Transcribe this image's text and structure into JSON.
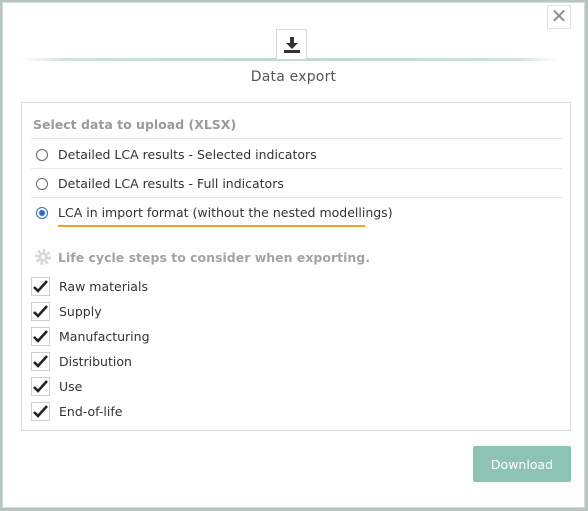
{
  "dialog": {
    "close_label": "✕",
    "title": "Data export",
    "header_icon": "download-icon"
  },
  "export": {
    "section_label": "Select data to upload (XLSX)",
    "options": [
      {
        "label": "Detailed LCA results - Selected indicators",
        "checked": false
      },
      {
        "label": "Detailed LCA results - Full indicators",
        "checked": false
      },
      {
        "label": "LCA in import format (without the nested modellings)",
        "checked": true
      }
    ],
    "highlight_color": "#f0a224"
  },
  "steps": {
    "label": "Life cycle steps to consider when exporting.",
    "icon": "gear-icon",
    "items": [
      {
        "label": "Raw materials",
        "checked": true
      },
      {
        "label": "Supply",
        "checked": true
      },
      {
        "label": "Manufacturing",
        "checked": true
      },
      {
        "label": "Distribution",
        "checked": true
      },
      {
        "label": "Use",
        "checked": true
      },
      {
        "label": "End-of-life",
        "checked": true
      }
    ]
  },
  "footer": {
    "download_label": "Download",
    "button_color": "#8dc3b5"
  }
}
